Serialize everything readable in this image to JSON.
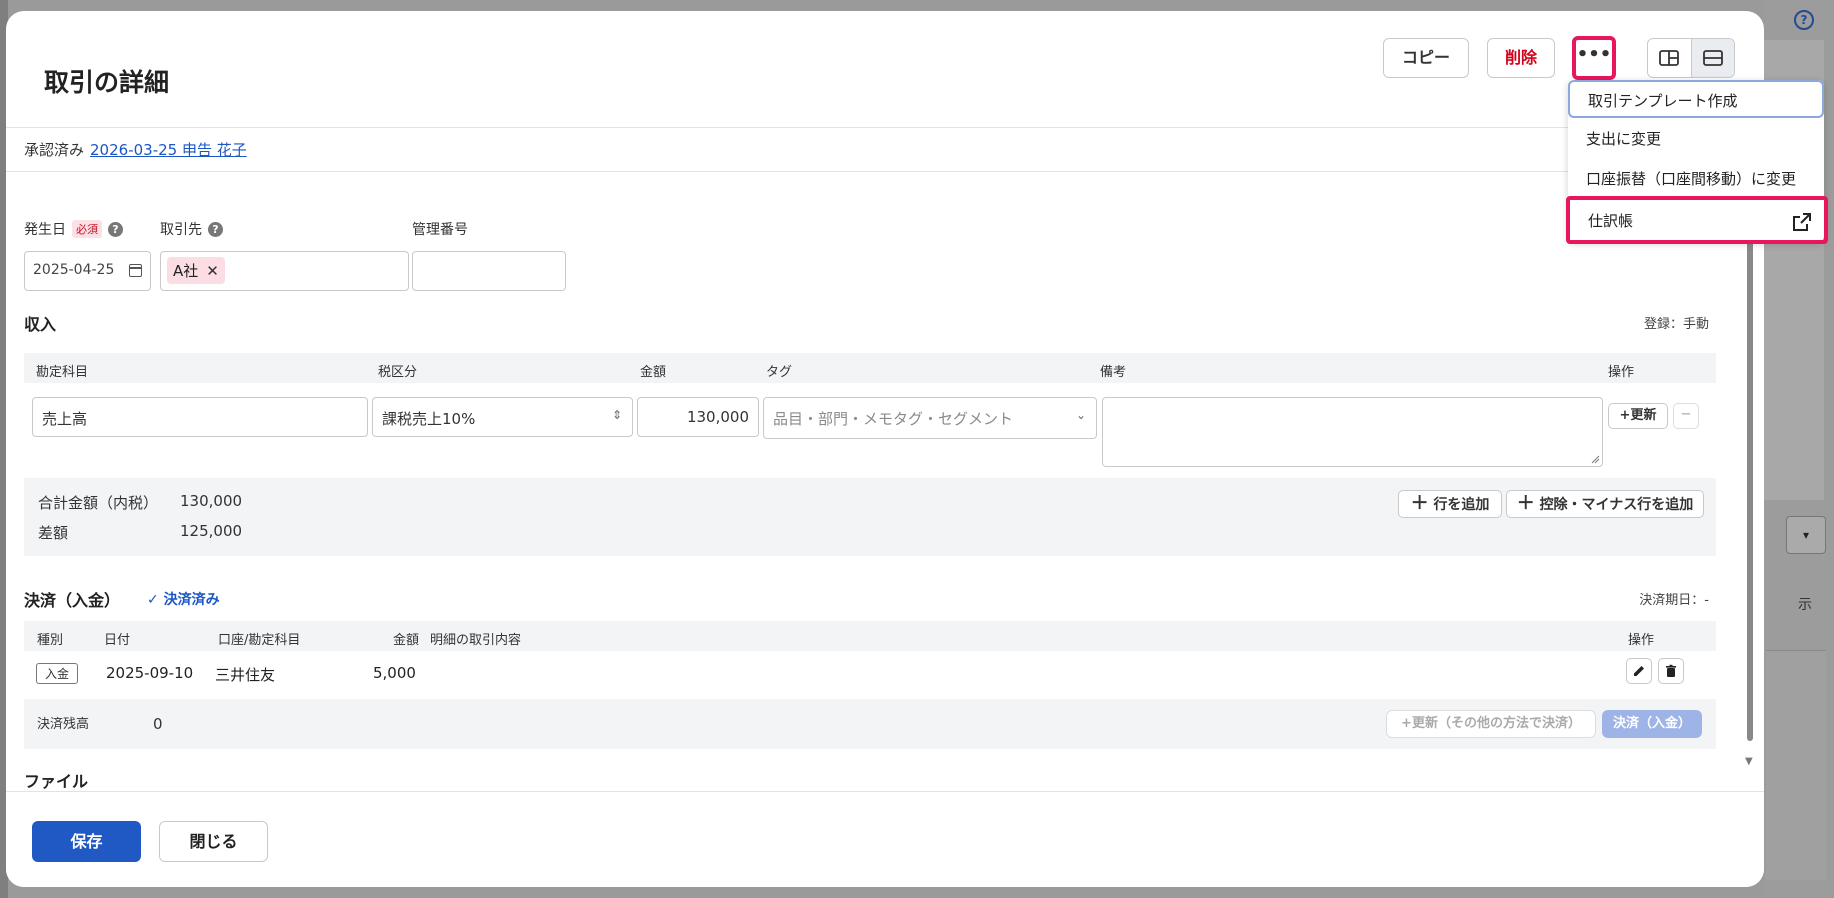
{
  "modal": {
    "title": "取引の詳細",
    "copy_label": "コピー",
    "delete_label": "削除",
    "more_label": "•••"
  },
  "status": {
    "text": "承認済み",
    "link": "2026-03-25 申告 花子"
  },
  "fields": {
    "date_label": "発生日",
    "required_badge": "必須",
    "date_value": "2025-04-25",
    "partner_label": "取引先",
    "partner_chip": "A社",
    "mgmt_label": "管理番号"
  },
  "income": {
    "title": "収入",
    "registration": "登録：手動",
    "columns": {
      "account": "勘定科目",
      "tax": "税区分",
      "amount": "金額",
      "tag": "タグ",
      "memo": "備考",
      "ops": "操作"
    },
    "row": {
      "account": "売上高",
      "tax": "課税売上10%",
      "amount": "130,000",
      "tag_placeholder": "品目・部門・メモタグ・セグメント",
      "update_btn": "+更新",
      "remove_btn": "−"
    },
    "summary": {
      "total_label": "合計金額（内税）",
      "total_value": "130,000",
      "diff_label": "差額",
      "diff_value": "125,000"
    },
    "add_row_btn": "行を追加",
    "add_deduction_btn": "控除・マイナス行を追加"
  },
  "settlement": {
    "title": "決済（入金）",
    "status": "決済済み",
    "due_date": "決済期日：-",
    "columns": {
      "type": "種別",
      "date": "日付",
      "account": "口座/勘定科目",
      "amount": "金額",
      "detail": "明細の取引内容",
      "ops": "操作"
    },
    "row": {
      "type": "入金",
      "date": "2025-09-10",
      "account": "三井住友",
      "amount": "5,000"
    },
    "balance_label": "決済残高",
    "balance_value": "0",
    "update_other_btn": "+更新（その他の方法で決済）",
    "settle_btn": "決済（入金）"
  },
  "file_section": "ファイル",
  "footer": {
    "save_label": "保存",
    "close_label": "閉じる"
  },
  "menu": {
    "items": [
      "取引テンプレート作成",
      "支出に変更",
      "口座振替（口座間移動）に変更",
      "仕訳帳"
    ]
  },
  "background": {
    "help_icon": "?",
    "select_caret": "▾",
    "side_text": "示"
  },
  "colors": {
    "primary": "#2159c4",
    "danger": "#d0021b",
    "highlight": "#e8175d",
    "link": "#1a56c4",
    "settle_btn_bg": "#9fb4e6"
  }
}
